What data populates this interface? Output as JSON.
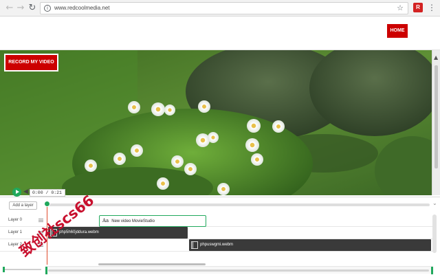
{
  "browser": {
    "back_icon": "back-arrow-icon",
    "forward_icon": "forward-arrow-icon",
    "reload_icon": "reload-icon",
    "url": "www.redcoolmedia.net",
    "back_glyph": "←",
    "forward_glyph": "→",
    "reload_glyph": "↻",
    "info_glyph": "i",
    "star_glyph": "☆",
    "menu_glyph": "⋮",
    "extension_label": "R"
  },
  "site": {
    "home_label": "HOME",
    "record_label": "RECORD MY VIDEO",
    "brand_color": "#cc0000"
  },
  "player": {
    "time_current": "0:00",
    "time_separator": "/",
    "time_total": "0:21",
    "accent_color": "#20a85c",
    "volume_glyph": "◀)"
  },
  "timeline": {
    "add_layer_label": "Add a layer",
    "layers": [
      {
        "label": "Layer 0"
      },
      {
        "label": "Layer 1"
      },
      {
        "label": "Layer 2"
      }
    ],
    "clips": {
      "text_clip": {
        "icon": "Aa",
        "label": "New video MovieStudio"
      },
      "video_clip_1": {
        "label": "php5h60jddura.webm"
      },
      "video_clip_2": {
        "label": "phpuswgmi.webm"
      }
    },
    "chevron_glyph": "⌄",
    "scroll_up_glyph": "▲"
  },
  "watermark": {
    "text": "致创社scs66"
  }
}
